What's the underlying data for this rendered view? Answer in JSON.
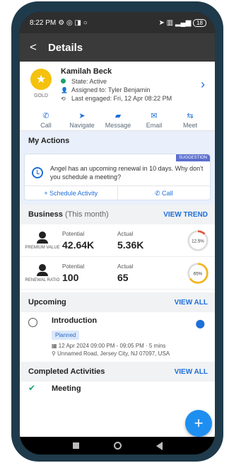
{
  "status": {
    "time": "8:22 PM",
    "battery": "18"
  },
  "header": {
    "back": "<",
    "title": "Details"
  },
  "profile": {
    "name": "Kamilah Beck",
    "badge": "GOLD",
    "state": "State: Active",
    "assigned": "Assigned to: Tyler Benjamin",
    "last_engaged": "Last engaged: Fri, 12 Apr  08:22 PM"
  },
  "actions": [
    {
      "label": "Call",
      "icon": "phone-icon"
    },
    {
      "label": "Navigate",
      "icon": "navigate-icon"
    },
    {
      "label": "Message",
      "icon": "message-icon"
    },
    {
      "label": "Email",
      "icon": "email-icon"
    },
    {
      "label": "Meet",
      "icon": "meet-icon"
    }
  ],
  "my_actions": {
    "title": "My Actions",
    "tag": "SUGGESTION",
    "text": "Angel has an upcoming renewal in 10 days. Why don't you schedule a meeting?",
    "schedule_label": "+ Schedule Activity",
    "call_label": "Call"
  },
  "business": {
    "title": "Business",
    "period": "(This month)",
    "link": "VIEW TREND",
    "metrics": [
      {
        "label": "PREMIUM VALUE",
        "potential_cap": "Potential",
        "potential": "42.64K",
        "actual_cap": "Actual",
        "actual": "5.36K",
        "ratio_text": "12.5%",
        "ratio": 0.125,
        "color": "#e0533d"
      },
      {
        "label": "RENEWAL RATIO",
        "potential_cap": "Potential",
        "potential": "100",
        "actual_cap": "Actual",
        "actual": "65",
        "ratio_text": "65%",
        "ratio": 0.65,
        "color": "#f2b51d"
      }
    ]
  },
  "upcoming": {
    "title": "Upcoming",
    "link": "VIEW ALL",
    "item": {
      "title": "Introduction",
      "status": "Planned",
      "time": "12 Apr 2024  09:00 PM - 09:05 PM · 5 mins",
      "location": "Unnamed Road, Jersey City, NJ 07097, USA"
    }
  },
  "completed": {
    "title": "Completed Activities",
    "link": "VIEW ALL",
    "item": "Meeting"
  },
  "fab": "+"
}
